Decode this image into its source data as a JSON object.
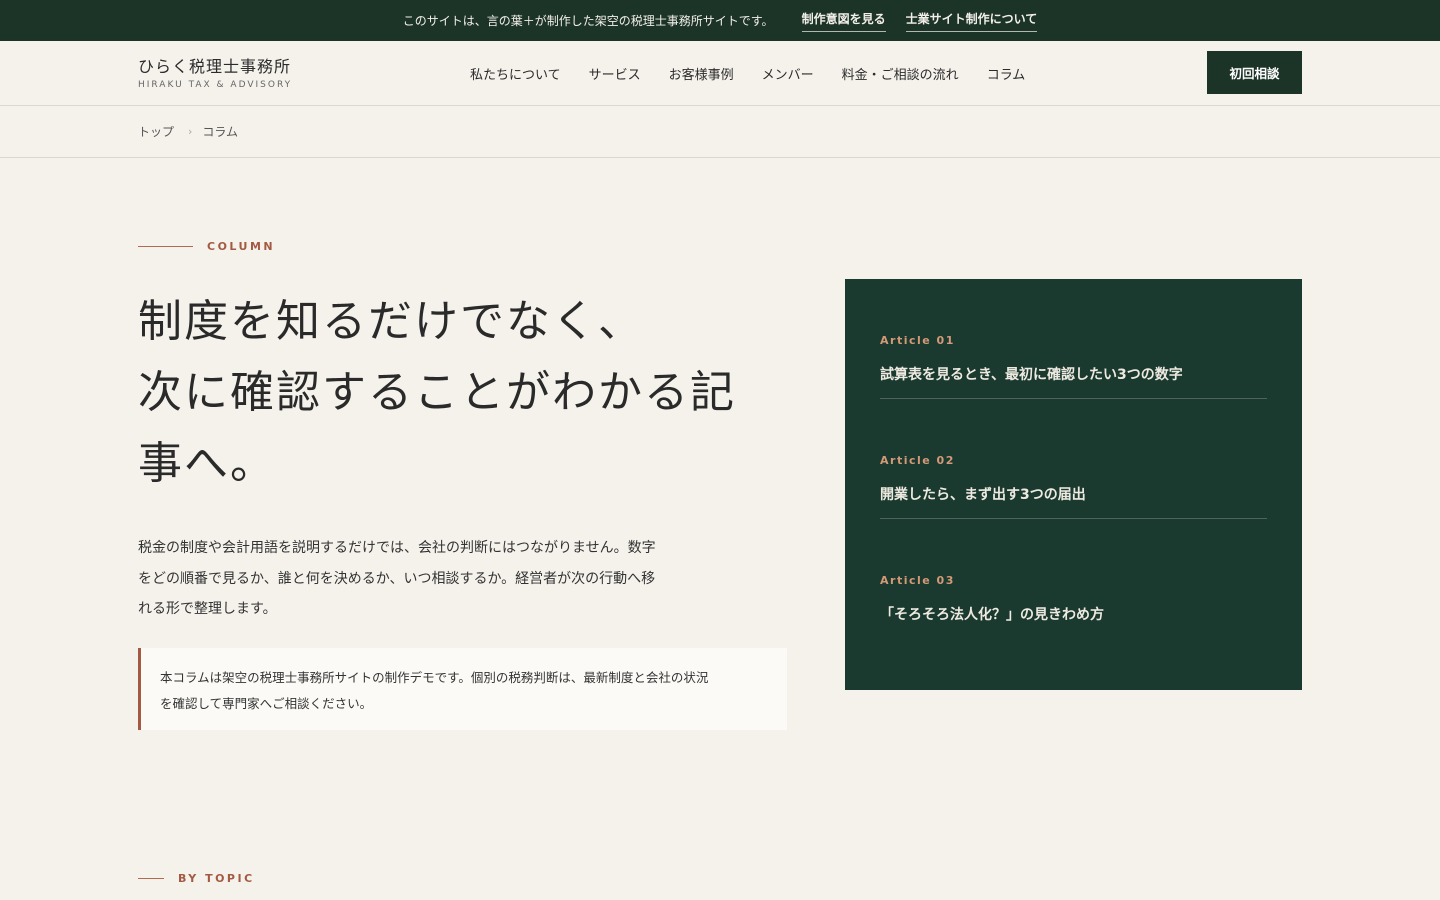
{
  "topbar": {
    "notice": "このサイトは、言の葉＋が制作した架空の税理士事務所サイトです。",
    "links": [
      "制作意図を見る",
      "士業サイト制作について"
    ]
  },
  "header": {
    "logo_main": "ひらく税理士事務所",
    "logo_sub": "HIRAKU TAX & ADVISORY",
    "nav": [
      "私たちについて",
      "サービス",
      "お客様事例",
      "メンバー",
      "料金・ご相談の流れ",
      "コラム"
    ],
    "cta": "初回相談"
  },
  "breadcrumb": {
    "items": [
      "トップ",
      "コラム"
    ],
    "separator": "›"
  },
  "hero": {
    "eyebrow": "COLUMN",
    "headline_lines": [
      "制度を知るだけでなく、",
      "次に確認することがわかる記",
      "事へ。"
    ],
    "lead_lines": [
      "税金の制度や会計用語を説明するだけでは、会社の判断にはつながりません。数字",
      "をどの順番で見るか、誰と何を決めるか、いつ相談するか。経営者が次の行動へ移",
      "れる形で整理します。"
    ],
    "note_lines": [
      "本コラムは架空の税理士事務所サイトの制作デモです。個別の税務判断は、最新制度と会社の状況",
      "を確認して専門家へご相談ください。"
    ]
  },
  "articles": [
    {
      "num": "Article 01",
      "title": "試算表を見るとき、最初に確認したい3つの数字"
    },
    {
      "num": "Article 02",
      "title": "開業したら、まず出す3つの届出"
    },
    {
      "num": "Article 03",
      "title": "「そろそろ法人化？」の見きわめ方"
    }
  ],
  "topic": {
    "eyebrow": "BY TOPIC"
  },
  "colors": {
    "dark_green": "#1c3328",
    "card_green": "#1b3a2f",
    "accent": "#a45a42",
    "background": "#f5f2ec"
  }
}
